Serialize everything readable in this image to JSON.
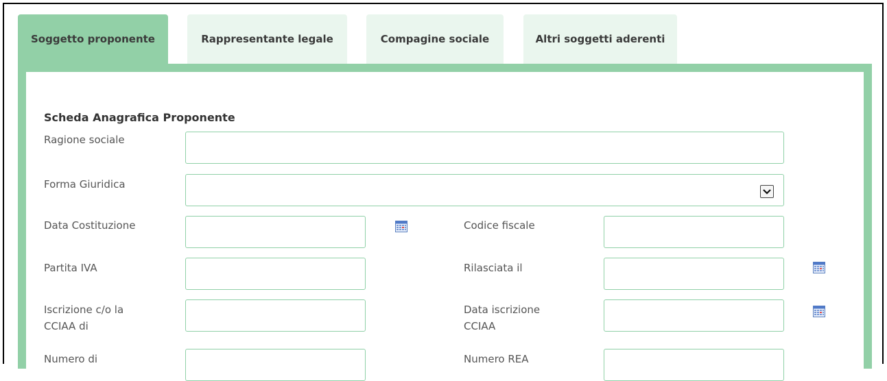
{
  "tabs": [
    {
      "label": "Soggetto proponente",
      "active": true
    },
    {
      "label": "Rappresentante legale",
      "active": false
    },
    {
      "label": "Compagine sociale",
      "active": false
    },
    {
      "label": "Altri soggetti aderenti",
      "active": false
    }
  ],
  "form": {
    "title": "Scheda Anagrafica Proponente",
    "ragione_sociale": {
      "label": "Ragione sociale",
      "value": ""
    },
    "forma_giuridica": {
      "label": "Forma Giuridica",
      "value": ""
    },
    "data_costituzione": {
      "label": "Data Costituzione",
      "value": ""
    },
    "codice_fiscale": {
      "label": "Codice fiscale",
      "value": ""
    },
    "partita_iva": {
      "label": "Partita IVA",
      "value": ""
    },
    "rilasciata_il": {
      "label": "Rilasciata il",
      "value": ""
    },
    "iscrizione_cciaa": {
      "label_line1": "Iscrizione c/o la",
      "label_line2": "CCIAA di",
      "value": ""
    },
    "data_iscrizione": {
      "label_line1": "Data iscrizione",
      "label_line2": "CCIAA",
      "value": ""
    },
    "numero_di": {
      "label": "Numero di",
      "value": ""
    },
    "numero_rea": {
      "label": "Numero REA",
      "value": ""
    }
  },
  "colors": {
    "accent": "#92d0a7",
    "tab_inactive": "#eaf6ee",
    "field_border": "#8fd0a7"
  },
  "icons": {
    "calendar": "calendar-icon",
    "dropdown": "chevron-down-icon"
  }
}
